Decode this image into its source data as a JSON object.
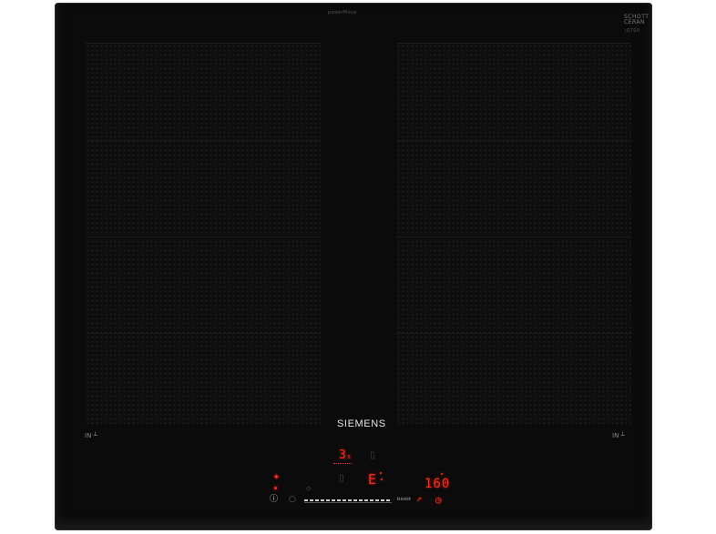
{
  "product": {
    "brand": "SIEMENS",
    "glass_brand_line1": "SCHOTT",
    "glass_brand_line2": "CERAN",
    "top_small_print": "powerMove",
    "right_small_print": "iQ700"
  },
  "zones": {
    "left_label": "IN",
    "right_label": "IN"
  },
  "display": {
    "left_zone_level": "3",
    "left_zone_level_suffix": "s",
    "right_zone_level": "E",
    "timer_value": "160",
    "boost_label": "boost"
  },
  "colors": {
    "glass": "#0b0b0b",
    "display_red": "#ff2a1a",
    "text_white": "#e6e6e6"
  },
  "icons": [
    "wifi-icon",
    "power-icon",
    "lock-icon",
    "boost-icon",
    "timer-icon",
    "frying-sensor-icon"
  ]
}
